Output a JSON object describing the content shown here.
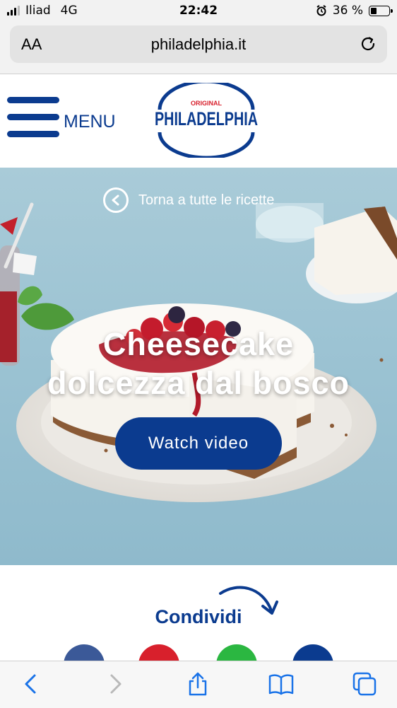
{
  "status_bar": {
    "carrier": "Iliad",
    "network": "4G",
    "time": "22:42",
    "battery": "36 %",
    "battery_level": 0.36
  },
  "browser": {
    "aa_label": "AA",
    "url": "philadelphia.it"
  },
  "header": {
    "menu_label": "MENU",
    "logo_top": "ORIGINAL",
    "logo_brand": "PHILADELPHIA"
  },
  "hero": {
    "back_label": "Torna a tutte le ricette",
    "title_line1": "Cheesecake",
    "title_line2": "dolcezza dal bosco",
    "watch_label": "Watch video"
  },
  "share": {
    "title": "Condividi",
    "networks": [
      "facebook-icon",
      "pinterest-icon",
      "whatsapp-icon",
      "email-icon"
    ]
  },
  "colors": {
    "brand_blue": "#0b3b8f",
    "facebook": "#3b5998",
    "pinterest": "#d8202c",
    "whatsapp": "#2bb741",
    "ios_blue": "#1a73e8"
  }
}
